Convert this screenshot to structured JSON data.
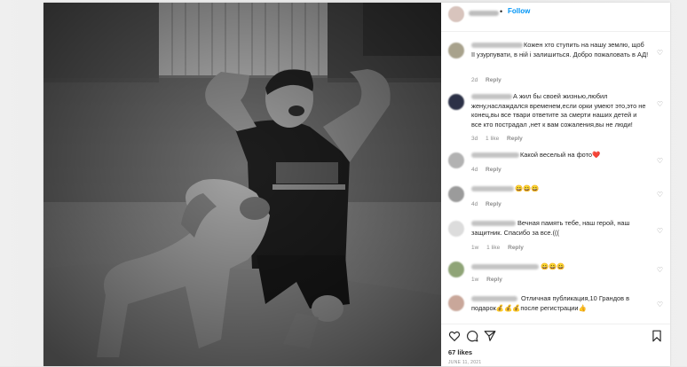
{
  "post": {
    "header": {
      "dot": "•",
      "follow_label": "Follow"
    },
    "comments": [
      {
        "text": "Кожен хто ступить на нашу землю, щоб її узурпувати, в ній і залишиться. Добро пожаловать в АД!",
        "time": "2d",
        "likes": "",
        "reply": "Reply",
        "avatar_color": "#a8a28c"
      },
      {
        "text": "А жил бы своей жизнью,любил жену,наслаждался временем,если орки умеют это,это не конец,вы все твари ответите за смерти наших детей и все кто пострадал ,нет к вам сожаления,вы не люди!",
        "time": "3d",
        "likes": "1 like",
        "reply": "Reply",
        "avatar_color": "#2c3147"
      },
      {
        "text": "Какой веселый на фото❤️",
        "time": "4d",
        "likes": "",
        "reply": "Reply",
        "avatar_color": "#b2b2b2"
      },
      {
        "text": "😀😀😀",
        "time": "4d",
        "likes": "",
        "reply": "Reply",
        "avatar_color": "#9b9b9b"
      },
      {
        "text": "Вечная память тебе, наш герой, наш защитник. Спасибо за все.(((",
        "time": "1w",
        "likes": "1 like",
        "reply": "Reply",
        "avatar_color": "#dcdcdc"
      },
      {
        "text": "😀😀😀",
        "time": "1w",
        "likes": "",
        "reply": "Reply",
        "avatar_color": "#8fa477"
      },
      {
        "text": "Отличная публикация,10 Грандов в подарок💰💰💰после регистрации👍",
        "time": "",
        "likes": "",
        "reply": "",
        "avatar_color": "#c9a79a"
      }
    ],
    "likes": "67 likes",
    "date": "JUNE 11, 2021",
    "icons": [
      "heart-icon",
      "comment-icon",
      "share-icon",
      "bookmark-icon"
    ]
  }
}
